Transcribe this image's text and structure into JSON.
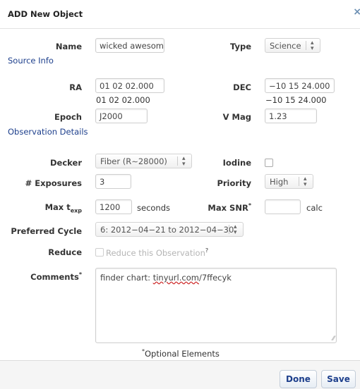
{
  "dialog": {
    "title": "ADD New Object",
    "close": "×"
  },
  "sections": {
    "source_info": "Source Info",
    "observation_details": "Observation Details"
  },
  "fields": {
    "name": {
      "label": "Name",
      "value": "wicked awesome tar("
    },
    "type": {
      "label": "Type",
      "value": "Science"
    },
    "ra": {
      "label": "RA",
      "value": "01 02 02.000",
      "echo": "01 02 02.000"
    },
    "dec": {
      "label": "DEC",
      "value": "−10 15 24.000",
      "echo": "−10 15 24.000"
    },
    "epoch": {
      "label": "Epoch",
      "value": "J2000"
    },
    "vmag": {
      "label": "V Mag",
      "value": "1.23"
    },
    "decker": {
      "label": "Decker",
      "value": "Fiber (R∼28000)"
    },
    "iodine": {
      "label": "Iodine",
      "checked": false
    },
    "exposures": {
      "label": "# Exposures",
      "value": "3"
    },
    "priority": {
      "label": "Priority",
      "value": "High"
    },
    "max_texp": {
      "label": "Max t",
      "label_sub": "exp",
      "value": "1200",
      "unit": "seconds"
    },
    "max_snr": {
      "label": "Max SNR",
      "label_sup": "*",
      "value": "",
      "unit": "calc"
    },
    "preferred_cycle": {
      "label": "Preferred Cycle",
      "value": "6: 2012−04−21 to 2012−04−30"
    },
    "reduce": {
      "label": "Reduce",
      "checkbox_text": "Reduce this Observation",
      "sup": "?",
      "checked": false
    },
    "comments": {
      "label": "Comments",
      "label_sup": "*",
      "value_prefix": "finder chart: ",
      "value_link": "tinyurl.com",
      "value_suffix": "/7ffecyk"
    }
  },
  "footnote": {
    "sup": "*",
    "text": "Optional Elements"
  },
  "buttons": {
    "done": "Done",
    "save": "Save"
  },
  "colors": {
    "section": "#1d3f8c",
    "button_text": "#1d3f8c",
    "close_icon": "#6b8fb3"
  }
}
